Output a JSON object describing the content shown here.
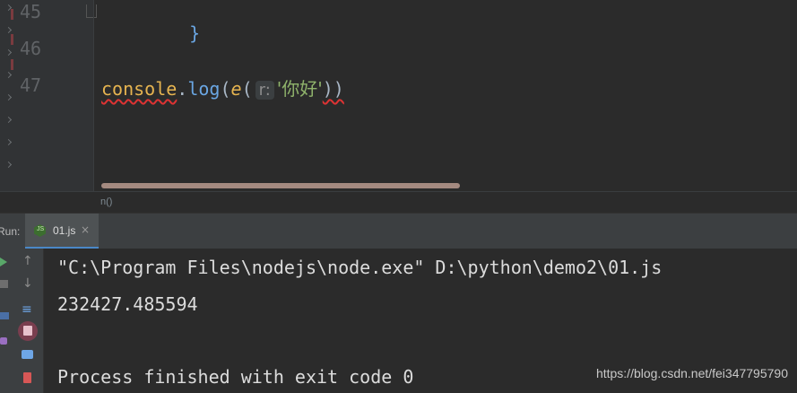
{
  "editor": {
    "line_numbers": [
      "45",
      "46",
      "47"
    ],
    "line45_text": "}",
    "code": {
      "object": "console",
      "dot": ".",
      "method": "log",
      "open_paren": "(",
      "func": "e",
      "open_paren2": "(",
      "param_hint": "r:",
      "string_arg": "'你好'",
      "close_parens": "))"
    },
    "breadcrumb": "n()"
  },
  "run_panel": {
    "label": "Run:",
    "tab": {
      "label": "01.js",
      "icon": "nodejs-icon",
      "close": "×"
    },
    "output": [
      "\"C:\\Program Files\\nodejs\\node.exe\" D:\\python\\demo2\\01.js",
      "232427.485594",
      "",
      "Process finished with exit code 0"
    ]
  },
  "watermark": "https://blog.csdn.net/fei347795790",
  "colors": {
    "bg": "#2b2b2b",
    "gutter": "#313335",
    "keyword_yellow": "#e6b450",
    "method_blue": "#6aa6e3",
    "string_green": "#8fb36b",
    "tab_accent": "#4a88c7"
  }
}
